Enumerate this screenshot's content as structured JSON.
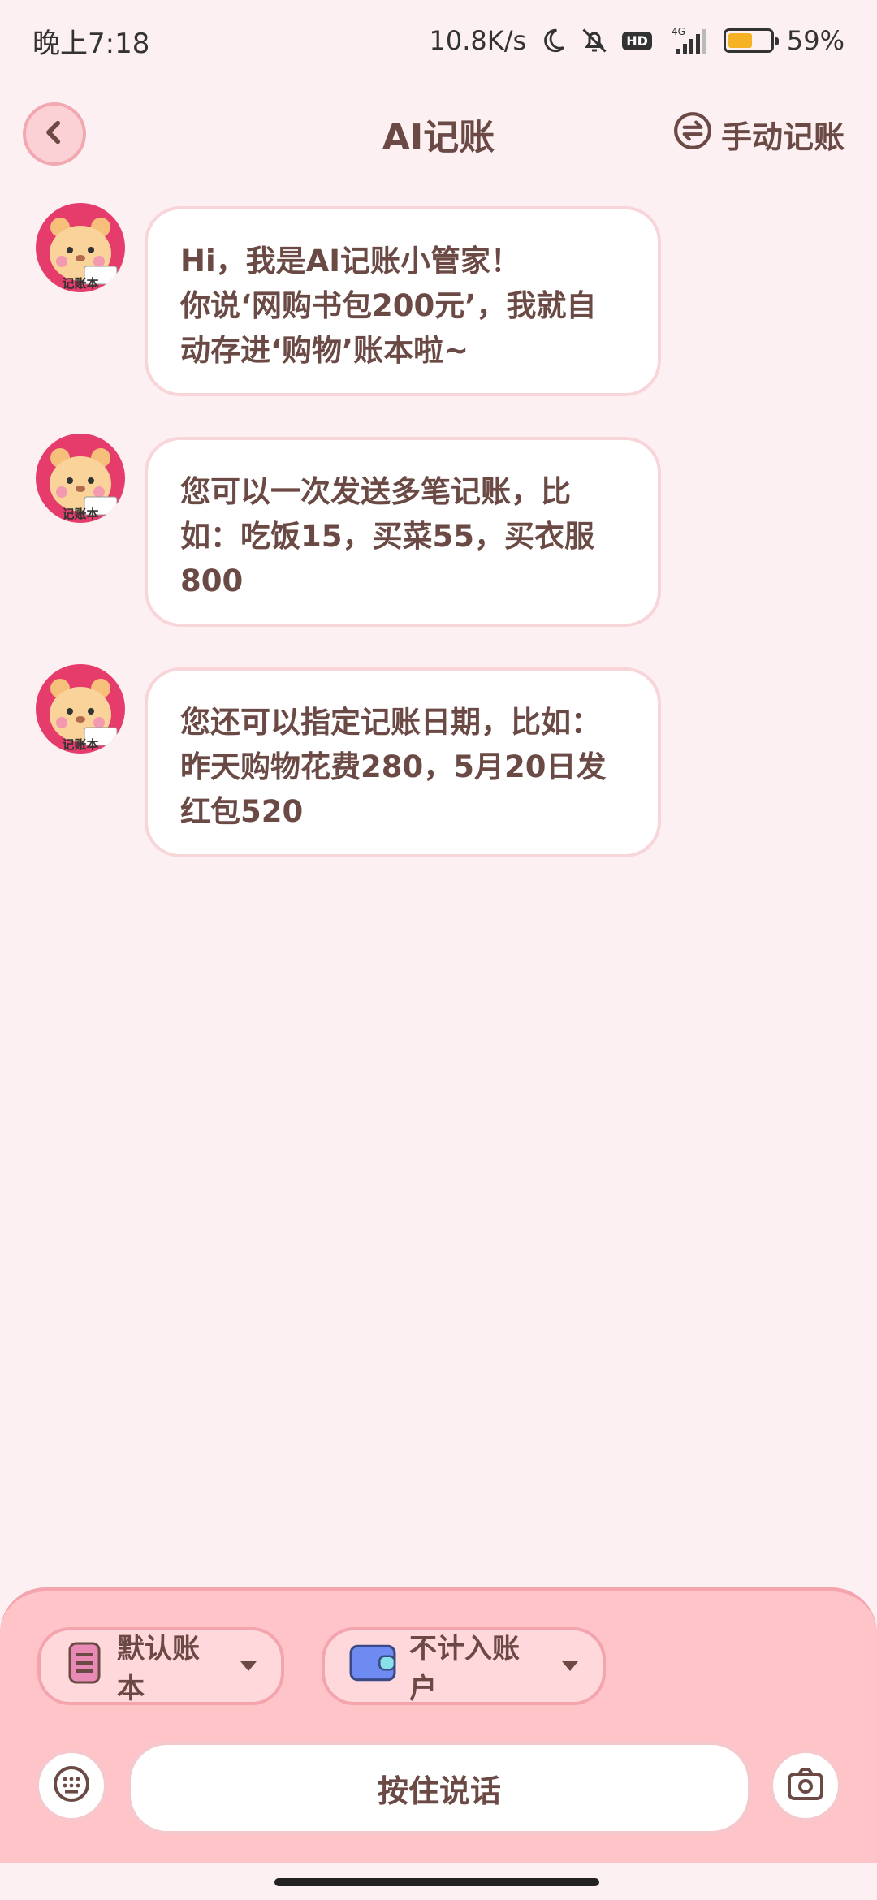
{
  "status_bar": {
    "time": "晚上7:18",
    "net_speed": "10.8K/s",
    "hd": "HD",
    "network": "4G",
    "battery_percent": "59%",
    "battery_level": 0.59
  },
  "header": {
    "title": "AI记账",
    "manual_label": "手动记账"
  },
  "messages": [
    {
      "avatar_caption": "记账本",
      "text": "Hi，我是AI记账小管家！\n你说‘网购书包200元’，我就自动存进‘购物’账本啦~"
    },
    {
      "avatar_caption": "记账本",
      "text": "您可以一次发送多笔记账，比如：吃饭15，买菜55，买衣服800"
    },
    {
      "avatar_caption": "记账本",
      "text": "您还可以指定记账日期，比如：昨天购物花费280，5月20日发红包520"
    }
  ],
  "bottom": {
    "book_label": "默认账本",
    "account_label": "不计入账户",
    "talk_label": "按住说话"
  },
  "colors": {
    "background": "#fdf0f2",
    "panel": "#ffc4c8",
    "accent_border": "#f3a4ad",
    "text": "#6b4a45"
  }
}
